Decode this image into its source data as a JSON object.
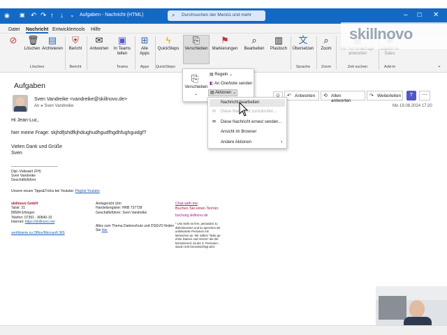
{
  "window": {
    "title": "Aufgaben - Nachricht (HTML)"
  },
  "search": {
    "placeholder": "Durchsuchen der Menüs und mehr"
  },
  "menu": [
    "Datei",
    "Nachricht",
    "Entwicklertools",
    "Hilfe"
  ],
  "ribbon": {
    "buttons": [
      "Löschen",
      "Archivieren",
      "Bericht",
      "Antworten",
      "In Teams teilen",
      "Alle Apps",
      "QuickSteps",
      "Verschieben",
      "Markierungen",
      "Bearbeiten",
      "Plastisch",
      "Übersetzen",
      "Zoom",
      "Mit Terminabfrage antworten",
      "Copilot for Sales"
    ],
    "groups": [
      "Löschen",
      "Bericht",
      "Teams",
      "Apps",
      "QuickSteps",
      "Sprache",
      "Zoom",
      "Zeit suchen",
      "Add-in"
    ]
  },
  "brand": {
    "name": "skillnovo"
  },
  "move_dropdown": {
    "big_label": "Verschieben",
    "regeln": "Regeln",
    "onenote": "An OneNote senden",
    "aktionen": "Aktionen"
  },
  "actions_menu": [
    "Nachricht bearbeiten",
    "Diese Nachricht zurückrufen...",
    "Diese Nachricht erneut senden...",
    "Ansicht im Browser",
    "Andere Aktionen"
  ],
  "message": {
    "subject": "Aufgaben",
    "from": "Sven Vandreike <vandreike@skillnovo.de>",
    "to_label": "An",
    "to": "Sven Vandreike",
    "date": "Mo 19.08.2024 17:20",
    "reply": "Antworten",
    "reply_all": "Allen antworten",
    "forward": "Weiterleiten",
    "greeting": "Hi Jean-Luc,",
    "body": "hier meine Frage: skjhdfjshdfkjhdiughudhgudfhgdhfughguidgf?",
    "closing": "Vielen Dank und Grüße",
    "signature_name": "Sven",
    "sig": {
      "sep": "________________________",
      "title": "Dipl.-Volkswirt (FH)",
      "name": "Sven Vandreike",
      "role": "Geschäftsführer",
      "tips": "Unsere neuen Tipps&Tricks bei Youtube:",
      "tips_link": "Playlist Youtube",
      "company": "skillnovo GmbH",
      "street": "Talstr. 21",
      "city": "89584 Ehingen",
      "phone": "Telefon:   07391 - 90840-10",
      "web_label": "Internet:",
      "web": "https://skillnovo.net",
      "trainer_link": "zertifizierte zu Office/Microsoft 365",
      "court": "Amtsgericht Ulm",
      "register": "Handelsregister: HRB 737728",
      "ceo": "Geschäftsführer: Sven Vandreike",
      "privacy": "Alles zum Thema Datenschutz und DSGVO finden Sie",
      "privacy_link": "hier",
      "chat": "Chat with me",
      "booking": "Buchen Sie einen Termin:",
      "booking_mail": "buchung.skillnovo.de",
      "gender": "* Uns steht es fern, jemanden zu diskriminieren und so sprechen wir unbekannte Personen mit Menschen an. Wir sollten \"liebe ge-ehrte Damen und Herren\" als dis-kriminierend, da der 3. Personen-stand nicht berücksichtigt wird."
    }
  }
}
